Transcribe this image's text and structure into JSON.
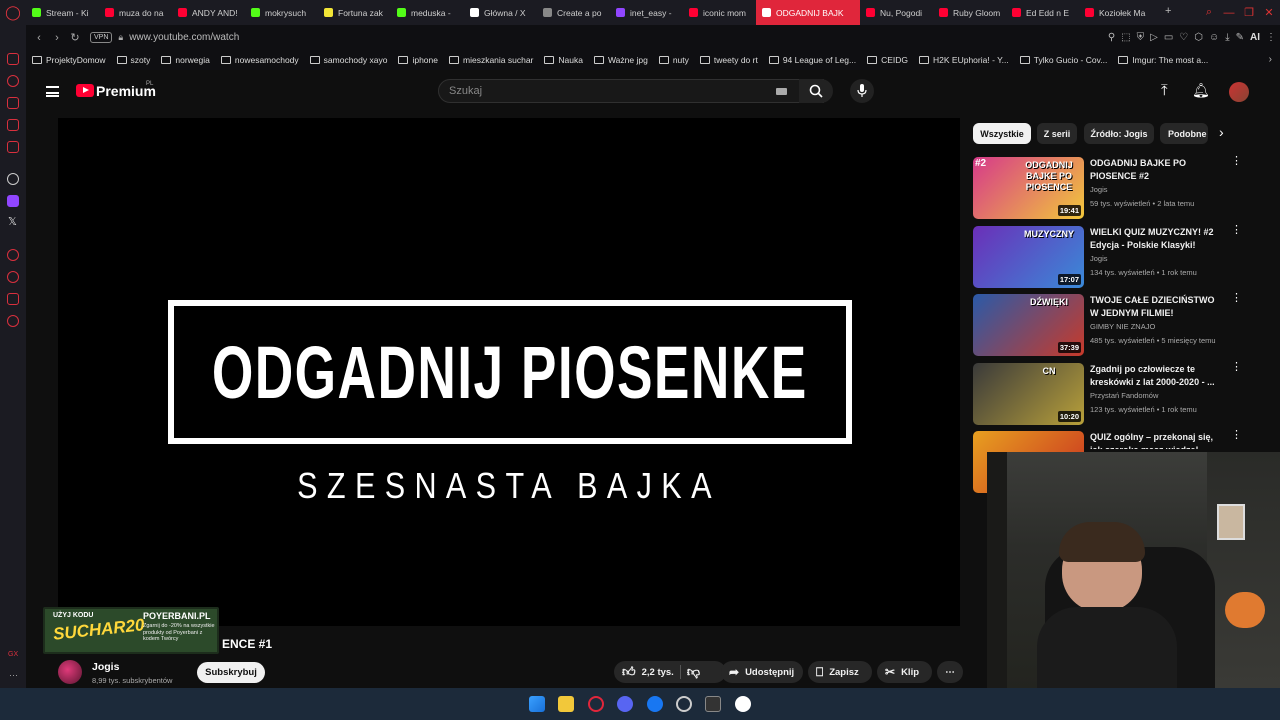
{
  "browser": {
    "tabs": [
      {
        "label": "Stream - Ki",
        "color": "#53fc18"
      },
      {
        "label": "muza do na",
        "color": "#ff0033"
      },
      {
        "label": "ANDY AND!",
        "color": "#ff0033"
      },
      {
        "label": "mokrysuch",
        "color": "#53fc18"
      },
      {
        "label": "Fortuna zak",
        "color": "#f2e537"
      },
      {
        "label": "meduska -",
        "color": "#53fc18"
      },
      {
        "label": "Główna / X",
        "color": "#ffffff"
      },
      {
        "label": "Create a po",
        "color": "#888888"
      },
      {
        "label": "inet_easy -",
        "color": "#9146ff"
      },
      {
        "label": "iconic mom",
        "color": "#ff0033"
      },
      {
        "label": "ODGADNIJ BAJK",
        "color": "#ffffff",
        "active": true
      },
      {
        "label": "Nu, Pogodi",
        "color": "#ff0033"
      },
      {
        "label": "Ruby Gloom",
        "color": "#ff0033"
      },
      {
        "label": "Ed Edd n E",
        "color": "#ff0033"
      },
      {
        "label": "Koziołek Ma",
        "color": "#ff0033"
      }
    ],
    "new_tab": "+",
    "vpn": "VPN",
    "url": "www.youtube.com/watch",
    "ai_label": "AI",
    "bookmarks": [
      "ProjektyDomow",
      "szoty",
      "norwegia",
      "nowesamochody",
      "samochody xayo",
      "iphone",
      "mieszkania suchar",
      "Nauka",
      "Ważne jpg",
      "nuty",
      "tweety do rt",
      "94 League of Leg...",
      "CEIDG",
      "H2K EUphoria! - Y...",
      "Tylko Gucio - Cov...",
      "Imgur: The most a..."
    ]
  },
  "youtube": {
    "logo_text": "Premium",
    "region": "PL",
    "search_placeholder": "Szukaj",
    "video": {
      "title_line": "ODGADNIJ PIOSENKE",
      "subtitle_line": "SZESNASTA BAJKA",
      "page_title_fragment": "ENCE #1"
    },
    "sponsor": {
      "top": "UŻYJ KODU",
      "code": "SUCHAR20",
      "brand": "POYERBANI.PL",
      "desc": "Zgarnij do -20% na wszystkie produkty od Poyerbani z kodem Twórcy"
    },
    "channel": {
      "name": "Jogis",
      "subscribers": "8,99 tys. subskrybentów",
      "subscribe": "Subskrybuj"
    },
    "actions": {
      "likes": "2,2 tys.",
      "share": "Udostępnij",
      "save": "Zapisz",
      "clip": "Klip"
    },
    "chips": [
      "Wszystkie",
      "Z serii",
      "Źródło: Jogis",
      "Podobne"
    ],
    "recommendations": [
      {
        "title": "ODGADNIJ BAJKE PO PIOSENCE #2",
        "channel": "Jogis",
        "meta": "59 tys. wyświetleń • 2 lata temu",
        "duration": "19:41",
        "badge": "#2",
        "thumb_text": "ODGADNIJ BAJKE PO PIOSENCE",
        "colors": [
          "#d63a8a",
          "#f2c83a"
        ]
      },
      {
        "title": "WIELKI QUIZ MUZYCZNY! #2 Edycja - Polskie Klasyki!",
        "channel": "Jogis",
        "meta": "134 tys. wyświetleń • 1 rok temu",
        "duration": "17:07",
        "thumb_text": "MUZYCZNY",
        "colors": [
          "#6b2fb8",
          "#3a8ad8"
        ]
      },
      {
        "title": "TWOJE CAŁE DZIECIŃSTWO W JEDNYM FILMIE!",
        "channel": "GIMBY NIE ZNAJO",
        "meta": "485 tys. wyświetleń • 5 miesięcy temu",
        "duration": "37:39",
        "thumb_text": "DŹWIĘKI",
        "colors": [
          "#2a5aa8",
          "#c83a2a"
        ]
      },
      {
        "title": "Zgadnij po człowiecze te kreskówki z lat 2000-2020 - ...",
        "channel": "Przystań Fandomów",
        "meta": "123 tys. wyświetleń • 1 rok temu",
        "duration": "10:20",
        "thumb_text": "CN",
        "colors": [
          "#3a3a3a",
          "#b8a03a"
        ]
      },
      {
        "title": "QUIZ ogólny – przekonaj się, jak szeroka masz wiedzę!",
        "channel": "",
        "meta": "",
        "duration": "",
        "thumb_text": "",
        "colors": [
          "#e8a020",
          "#c83020"
        ]
      }
    ]
  },
  "taskbar": {
    "icons": [
      "windows-start",
      "file-explorer",
      "opera-gx",
      "discord",
      "facebook",
      "settings",
      "terminal",
      "app"
    ]
  }
}
